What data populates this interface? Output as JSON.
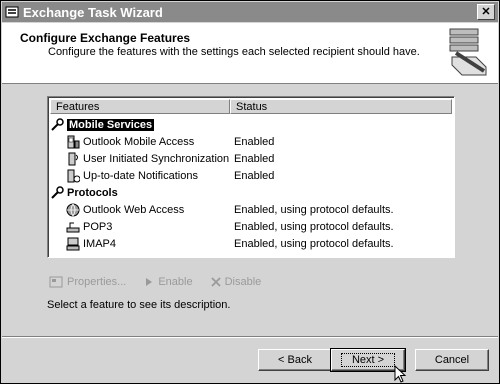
{
  "window": {
    "title": "Exchange Task Wizard",
    "close_label": "✕"
  },
  "header": {
    "title": "Configure Exchange Features",
    "subtitle": "Configure the features with the settings each selected recipient should have."
  },
  "list": {
    "columns": [
      "Features",
      "Status"
    ],
    "groups": [
      {
        "label": "Mobile Services",
        "items": [
          {
            "name": "Outlook Mobile Access",
            "status": "Enabled"
          },
          {
            "name": "User Initiated Synchronization",
            "status": "Enabled"
          },
          {
            "name": "Up-to-date Notifications",
            "status": "Enabled"
          }
        ]
      },
      {
        "label": "Protocols",
        "items": [
          {
            "name": "Outlook Web Access",
            "status": "Enabled, using protocol defaults."
          },
          {
            "name": "POP3",
            "status": "Enabled, using protocol defaults."
          },
          {
            "name": "IMAP4",
            "status": "Enabled, using protocol defaults."
          }
        ]
      }
    ]
  },
  "toolbar": {
    "properties": "Properties...",
    "enable": "Enable",
    "disable": "Disable"
  },
  "description": "Select a feature to see its description.",
  "buttons": {
    "back": "< Back",
    "next": "Next >",
    "cancel": "Cancel"
  }
}
